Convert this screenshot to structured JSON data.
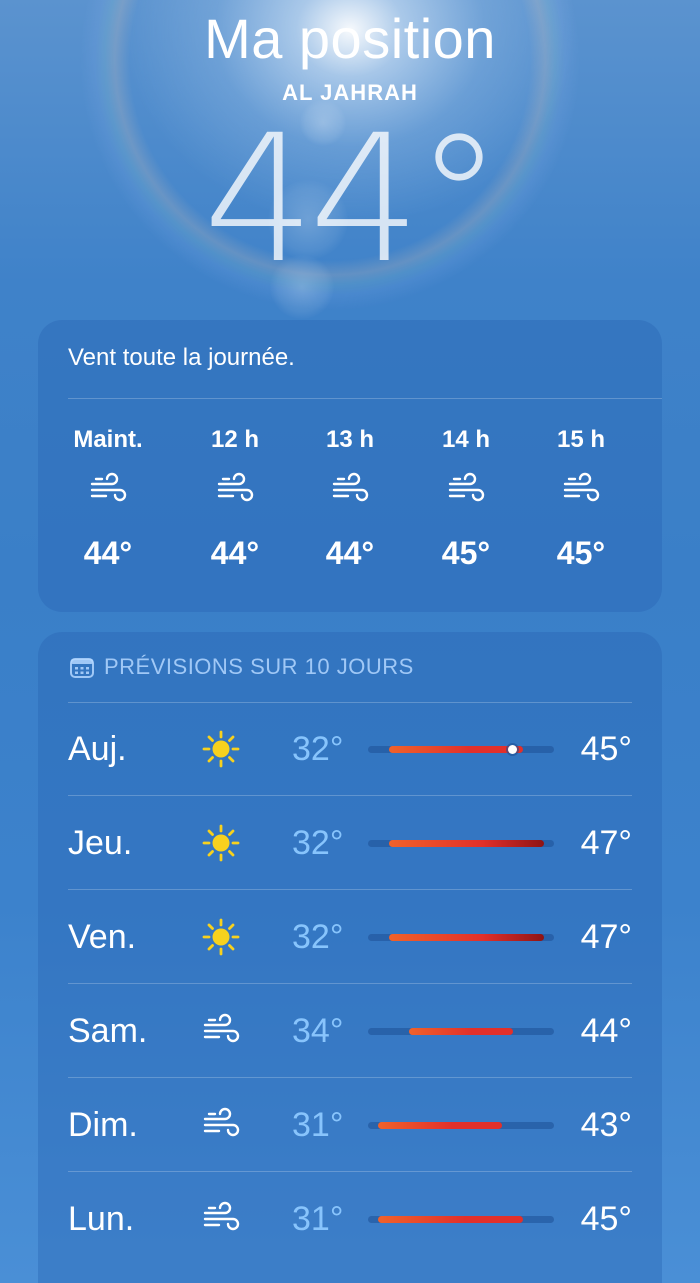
{
  "location": {
    "title": "Ma position",
    "subtitle": "AL JAHRAH",
    "current_temp": "44°"
  },
  "hourly": {
    "summary": "Vent toute la journée.",
    "items": [
      {
        "label": "Maint.",
        "icon": "wind-icon",
        "temp": "44°"
      },
      {
        "label": "12 h",
        "icon": "wind-icon",
        "temp": "44°"
      },
      {
        "label": "13 h",
        "icon": "wind-icon",
        "temp": "44°"
      },
      {
        "label": "14 h",
        "icon": "wind-icon",
        "temp": "45°"
      },
      {
        "label": "15 h",
        "icon": "wind-icon",
        "temp": "45°"
      }
    ]
  },
  "daily": {
    "header": "PRÉVISIONS SUR 10 JOURS",
    "header_icon": "calendar-icon",
    "range": {
      "min": 30,
      "max": 48
    },
    "days": [
      {
        "name": "Auj.",
        "icon": "sun-icon",
        "low": "32°",
        "high": "45°",
        "low_value": 32,
        "high_value": 45,
        "current_value": 44
      },
      {
        "name": "Jeu.",
        "icon": "sun-icon",
        "low": "32°",
        "high": "47°",
        "low_value": 32,
        "high_value": 47
      },
      {
        "name": "Ven.",
        "icon": "sun-icon",
        "low": "32°",
        "high": "47°",
        "low_value": 32,
        "high_value": 47
      },
      {
        "name": "Sam.",
        "icon": "wind-icon",
        "low": "34°",
        "high": "44°",
        "low_value": 34,
        "high_value": 44
      },
      {
        "name": "Dim.",
        "icon": "wind-icon",
        "low": "31°",
        "high": "43°",
        "low_value": 31,
        "high_value": 43
      },
      {
        "name": "Lun.",
        "icon": "wind-icon",
        "low": "31°",
        "high": "45°",
        "low_value": 31,
        "high_value": 45
      }
    ]
  },
  "colors": {
    "sun": "#f7d11e",
    "low_temp": "#8cc8ff",
    "bar_warm": "#f0622a",
    "bar_hot": "#e2302a",
    "bar_hottest": "#8e1414"
  }
}
